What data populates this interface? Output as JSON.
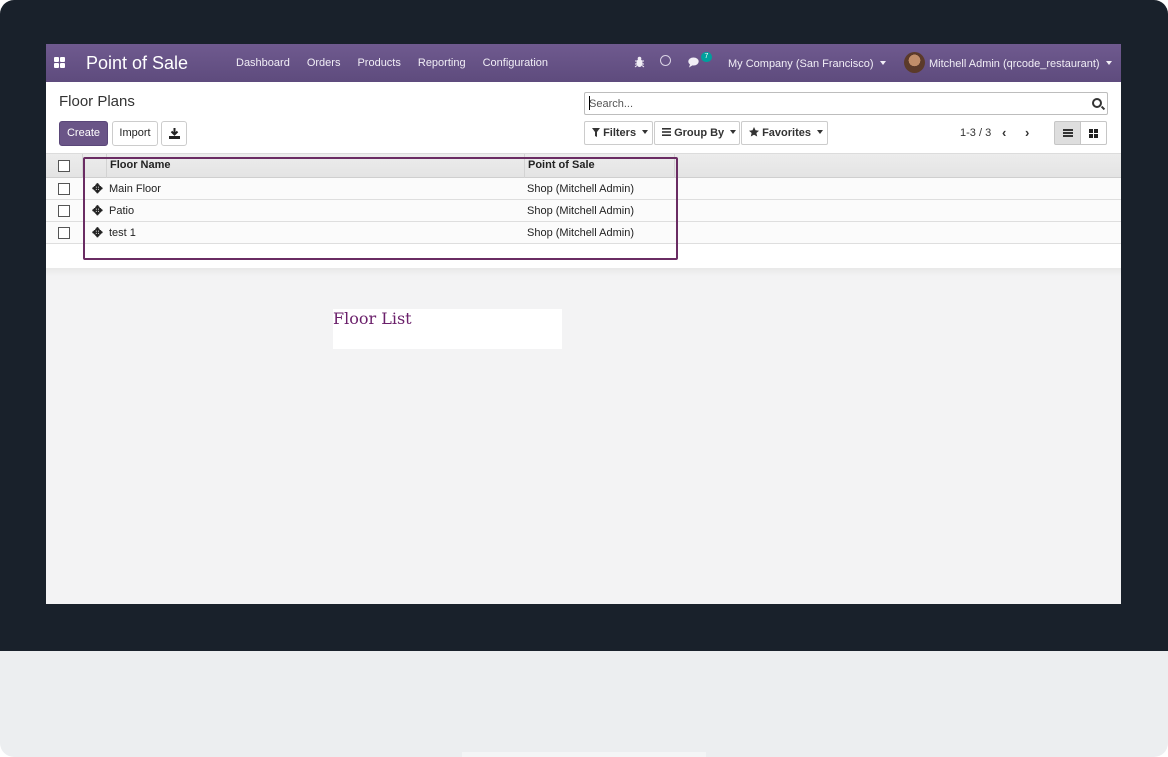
{
  "navbar": {
    "app_title": "Point of Sale",
    "menu": [
      "Dashboard",
      "Orders",
      "Products",
      "Reporting",
      "Configuration"
    ],
    "message_count": "7",
    "company": "My Company (San Francisco)",
    "user": "Mitchell Admin (qrcode_restaurant)"
  },
  "control_panel": {
    "title": "Floor Plans",
    "create_label": "Create",
    "import_label": "Import",
    "search_placeholder": "Search...",
    "filters_label": "Filters",
    "group_by_label": "Group By",
    "favorites_label": "Favorites",
    "pager": "1-3 / 3"
  },
  "table": {
    "columns": [
      "Floor Name",
      "Point of Sale"
    ],
    "rows": [
      {
        "floor_name": "Main Floor",
        "point_of_sale": "Shop (Mitchell Admin)"
      },
      {
        "floor_name": "Patio",
        "point_of_sale": "Shop (Mitchell Admin)"
      },
      {
        "floor_name": "test 1",
        "point_of_sale": "Shop (Mitchell Admin)"
      }
    ]
  },
  "caption": "Floor  List",
  "colors": {
    "navbar": "#6a5587",
    "primary_button": "#6a5587",
    "highlight_border": "#6a2c63",
    "caption_text": "#6a1f6a",
    "monitor_frame": "#19212b"
  }
}
